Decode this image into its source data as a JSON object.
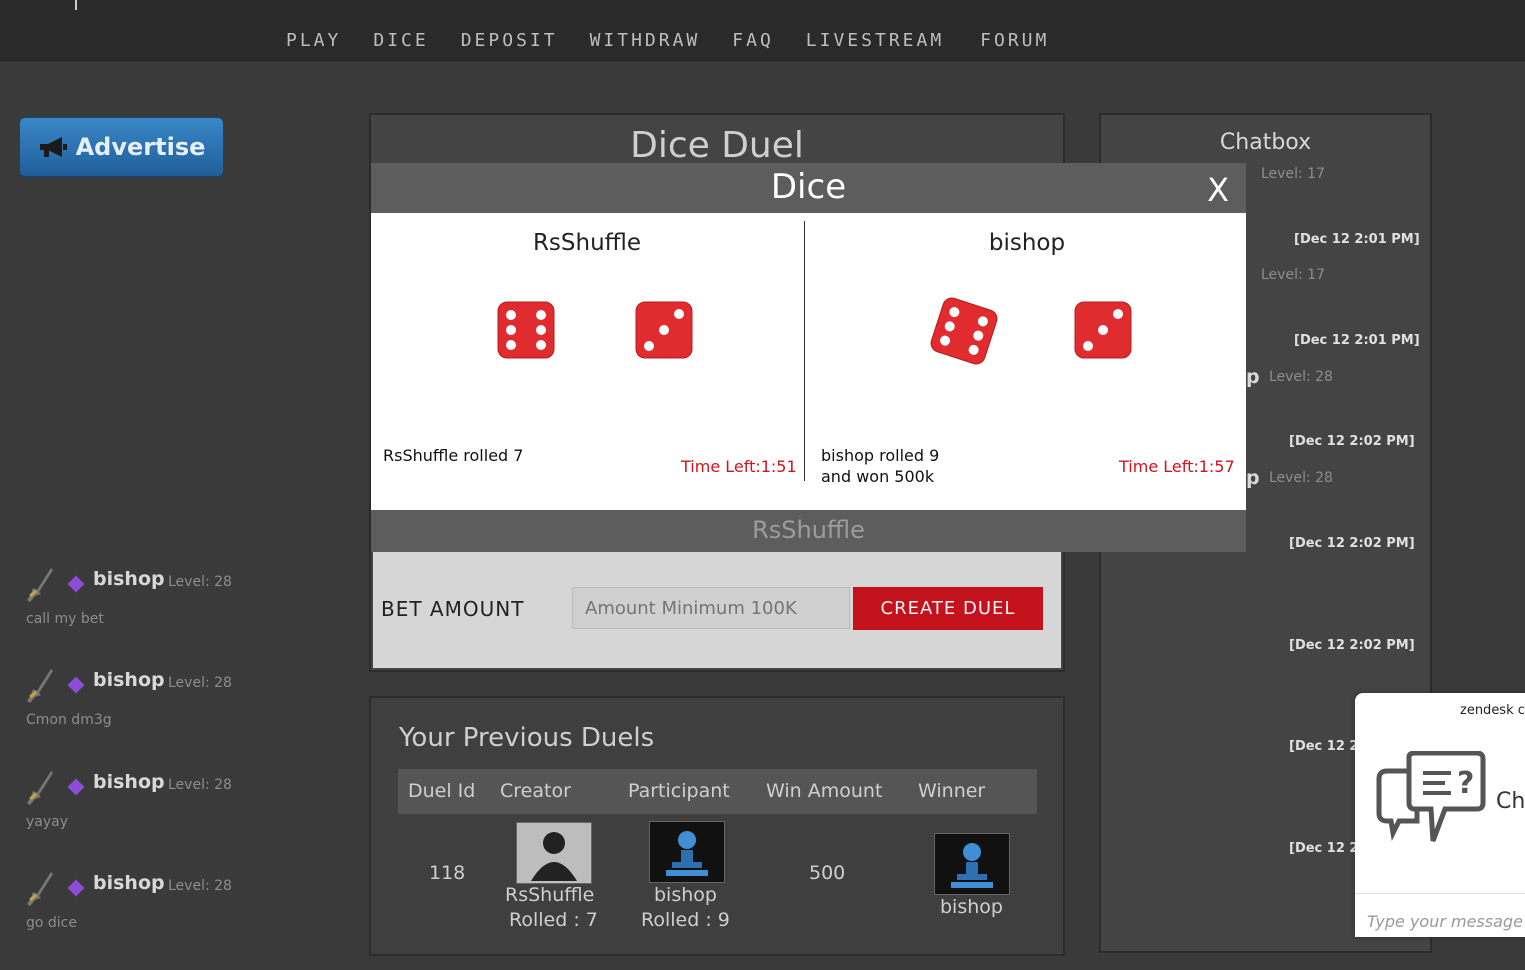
{
  "nav": {
    "items": [
      "PLAY",
      "DICE",
      "DEPOSIT",
      "WITHDRAW",
      "FAQ",
      "LIVESTREAM",
      "FORUM"
    ]
  },
  "advertise": {
    "label": "Advertise"
  },
  "duel": {
    "title": "Dice Duel",
    "bet_label": "BET AMOUNT",
    "bet_placeholder": "Amount Minimum 100K",
    "create_label": "CREATE DUEL"
  },
  "modal": {
    "title": "Dice",
    "close": "X",
    "left": {
      "name": "RsShuffle",
      "rolled": "RsShuffle rolled 7",
      "time_left": "Time Left:1:51",
      "dice": [
        6,
        3
      ]
    },
    "right": {
      "name": "bishop",
      "rolled_1": "bishop rolled 9",
      "rolled_2": "and won 500k",
      "time_left": "Time Left:1:57",
      "dice": [
        6,
        3
      ]
    },
    "footer": "RsShuffle",
    "die_color": "#e02b2f"
  },
  "previous": {
    "title": "Your Previous Duels",
    "headers": [
      "Duel Id",
      "Creator",
      "Participant",
      "Win Amount",
      "Winner"
    ],
    "row": {
      "duel_id": "118",
      "creator": "RsShuffle",
      "creator_rolled": "Rolled : 7",
      "participant": "bishop",
      "participant_rolled": "Rolled : 9",
      "win_amount": "500",
      "winner": "bishop"
    }
  },
  "chat": {
    "title": "Chatbox",
    "level_17": "Level: 17",
    "level_28": "Level: 28",
    "ts_201": "[Dec 12 2:01 PM]",
    "ts_202": "[Dec 12 2:02 PM]",
    "ts_partial": "[Dec 12 2",
    "partial_name": "p",
    "messages": [
      {
        "name": "bishop",
        "level": "Level: 28",
        "text": "call my bet"
      },
      {
        "name": "bishop",
        "level": "Level: 28",
        "text": "Cmon dm3g"
      },
      {
        "name": "bishop",
        "level": "Level: 28",
        "text": "yayay"
      },
      {
        "name": "bishop",
        "level": "Level: 28",
        "text": "go dice"
      }
    ]
  },
  "zendesk": {
    "label": "zendesk c",
    "ch": "Ch",
    "input_placeholder": "Type your message h"
  }
}
